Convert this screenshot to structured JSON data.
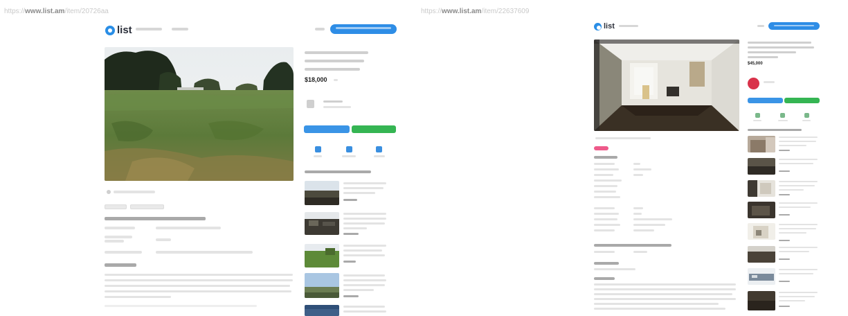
{
  "left_page": {
    "url_faint": "https://",
    "url_host": "www.list.am",
    "url_path": "/item/20726aa",
    "logo_text": "list",
    "price": "$18,000",
    "colors": {
      "brand": "#2e8de6",
      "call_button": "#3a94e6",
      "message_button": "#35b553"
    },
    "icons": [
      "logo-icon",
      "map-pin-icon",
      "photo-icon",
      "heart-icon",
      "share-icon",
      "flag-icon"
    ],
    "similar_count": 5
  },
  "right_page": {
    "url_faint": "https://",
    "url_host": "www.list.am",
    "url_path": "/item/22637609",
    "logo_text": "list",
    "price": "$45,000",
    "colors": {
      "brand": "#2e8de6",
      "call_button": "#3a94e6",
      "message_button": "#35b553",
      "avatar": "#d9324a",
      "tag": "#ee5a8a"
    },
    "icons": [
      "logo-icon",
      "heart-icon",
      "share-icon",
      "flag-icon"
    ],
    "similar_count": 8
  }
}
